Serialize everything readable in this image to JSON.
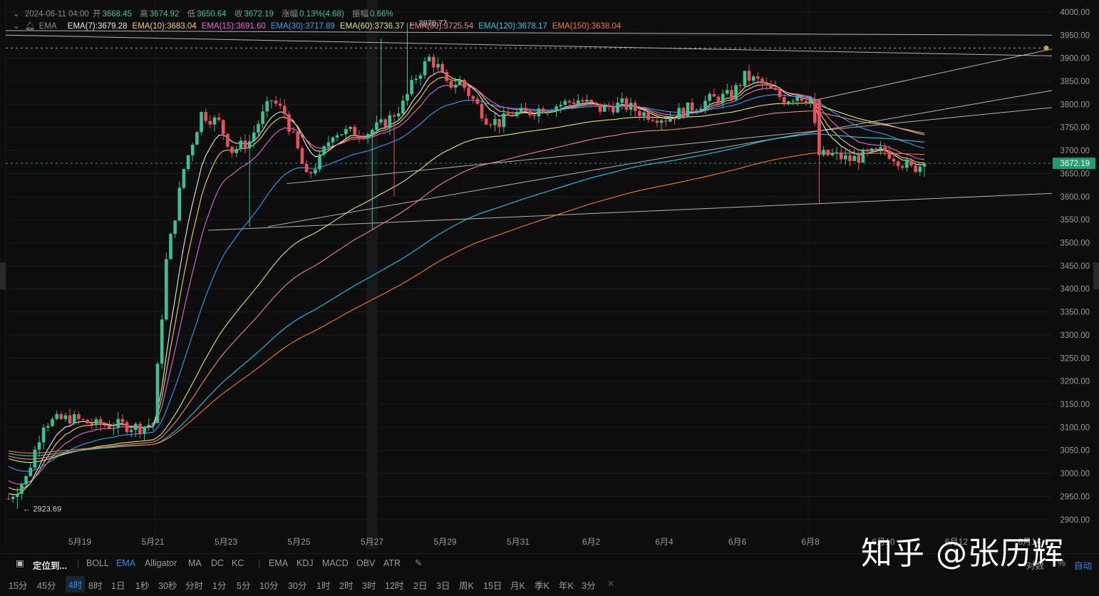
{
  "header": {
    "datetime": "2024-06-11 04:00",
    "open_label": "开",
    "open": "3668.45",
    "high_label": "高",
    "high": "3674.92",
    "low_label": "低",
    "low": "3650.64",
    "close_label": "收",
    "close": "3672.19",
    "change_label": "涨幅",
    "change": "0.13%(4.68)",
    "amp_label": "振幅",
    "amp": "0.66%"
  },
  "indicator": {
    "name": "EMA",
    "items": [
      {
        "label": "EMA(7):3679.28",
        "color": "#e8e8e8"
      },
      {
        "label": "EMA(10):3683.04",
        "color": "#f5d04a"
      },
      {
        "label": "EMA(15):3691.60",
        "color": "#e46ad0"
      },
      {
        "label": "EMA(30):3717.89",
        "color": "#2fa0ea"
      },
      {
        "label": "EMA(60):3736.37",
        "color": "#d9e77a"
      },
      {
        "label": "EMA(80):3725.54",
        "color": "#e58a8a"
      },
      {
        "label": "EMA(120):3678.17",
        "color": "#27c7e0"
      },
      {
        "label": "EMA(150):3638.04",
        "color": "#f07a2a"
      }
    ]
  },
  "price_tag": {
    "value": "3672.19",
    "color": "#1f9e6e"
  },
  "annotations": {
    "high": "← 3976.77",
    "low": "← 2923.69"
  },
  "toolbar": {
    "locate": "定位到...",
    "indicators": [
      "BOLL",
      "EMA",
      "Alligator",
      "MA",
      "DC",
      "KC"
    ],
    "sub_indicators": [
      "EMA",
      "KDJ",
      "MACD",
      "OBV",
      "ATR"
    ],
    "right": [
      "对数",
      "%",
      "自动"
    ]
  },
  "timeframes": [
    "15分",
    "45分",
    "4时",
    "8时",
    "1日",
    "1秒",
    "30秒",
    "分时",
    "1分",
    "5分",
    "10分",
    "30分",
    "1时",
    "2时",
    "3时",
    "12时",
    "2日",
    "3日",
    "周K",
    "15日",
    "月K",
    "季K",
    "年K",
    "3分"
  ],
  "active_timeframe": "4时",
  "watermark": "知乎 @张历辉",
  "colors": {
    "up": "#3cc190",
    "down": "#e8505b",
    "bg": "#0d0d0e",
    "grid": "#1c1c1f"
  },
  "chart_data": {
    "type": "candlestick",
    "x_labels": [
      "5月19",
      "5月21",
      "5月23",
      "5月25",
      "5月27",
      "5月29",
      "5月31",
      "6月2",
      "6月4",
      "6月6",
      "6月8",
      "6月10",
      "6月12",
      "6月14"
    ],
    "y_ticks": [
      "4000.00",
      "3950.00",
      "3900.00",
      "3850.00",
      "3800.00",
      "3750.00",
      "3700.00",
      "3650.00",
      "3600.00",
      "3550.00",
      "3500.00",
      "3450.00",
      "3400.00",
      "3350.00",
      "3300.00",
      "3250.00",
      "3200.00",
      "3150.00",
      "3100.00",
      "3050.00",
      "3000.00",
      "2950.00",
      "2900.00"
    ],
    "ylim": [
      2875,
      4020
    ],
    "last_price": 3672.19,
    "high_marker": 3976.77,
    "low_marker": 2923.69,
    "ema_last": {
      "EMA7": 3679.28,
      "EMA10": 3683.04,
      "EMA15": 3691.6,
      "EMA30": 3717.89,
      "EMA60": 3736.37,
      "EMA80": 3725.54,
      "EMA120": 3678.17,
      "EMA150": 3638.04
    }
  }
}
